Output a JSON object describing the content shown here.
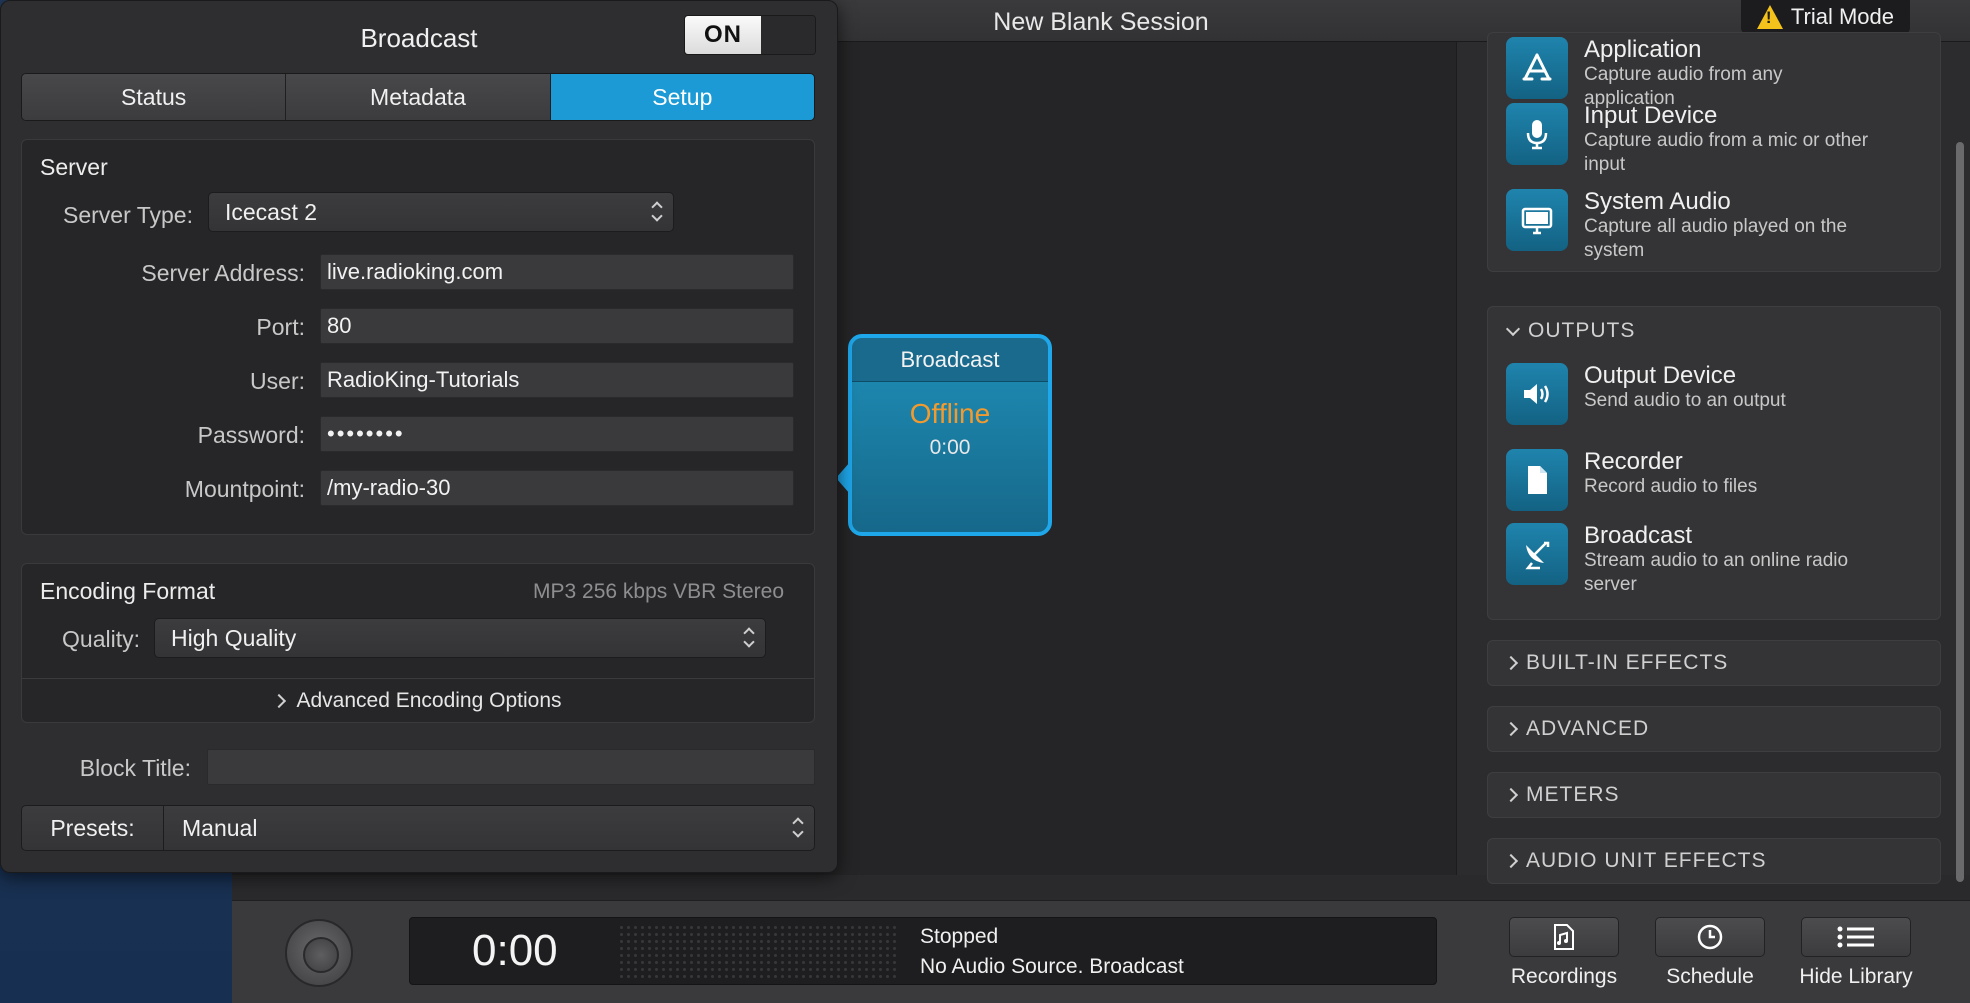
{
  "window": {
    "title": "New Blank Session",
    "trial_badge": "Trial Mode"
  },
  "panel": {
    "title": "Broadcast",
    "toggle": "ON",
    "tabs": [
      {
        "label": "Status",
        "active": false
      },
      {
        "label": "Metadata",
        "active": false
      },
      {
        "label": "Setup",
        "active": true
      }
    ],
    "server": {
      "heading": "Server",
      "type_label": "Server Type:",
      "type_value": "Icecast 2",
      "address_label": "Server Address:",
      "address_value": "live.radioking.com",
      "port_label": "Port:",
      "port_value": "80",
      "user_label": "User:",
      "user_value": "RadioKing-Tutorials",
      "password_label": "Password:",
      "password_value": "••••••••",
      "mountpoint_label": "Mountpoint:",
      "mountpoint_value": "/my-radio-30"
    },
    "encoding": {
      "heading": "Encoding Format",
      "summary": "MP3 256 kbps VBR Stereo",
      "quality_label": "Quality:",
      "quality_value": "High Quality",
      "advanced_label": "Advanced Encoding Options"
    },
    "block_title_label": "Block Title:",
    "block_title_value": "",
    "presets_label": "Presets:",
    "presets_value": "Manual"
  },
  "block": {
    "title": "Broadcast",
    "status": "Offline",
    "time": "0:00",
    "status_color": "#f39a2e",
    "accent": "#1ea7ea"
  },
  "library": {
    "sources": [
      {
        "title": "Application",
        "desc": "Capture audio from any application",
        "icon": "app-store-icon"
      },
      {
        "title": "Input Device",
        "desc": "Capture audio from a mic or other input",
        "icon": "microphone-icon"
      },
      {
        "title": "System Audio",
        "desc": "Capture all audio played on the system",
        "icon": "monitor-icon"
      }
    ],
    "outputs_heading": "OUTPUTS",
    "outputs": [
      {
        "title": "Output Device",
        "desc": "Send audio to an output",
        "icon": "speaker-icon"
      },
      {
        "title": "Recorder",
        "desc": "Record audio to files",
        "icon": "document-icon"
      },
      {
        "title": "Broadcast",
        "desc": "Stream audio to an online radio server",
        "icon": "satellite-dish-icon"
      }
    ],
    "collapsed_sections": [
      "BUILT-IN EFFECTS",
      "ADVANCED",
      "METERS",
      "AUDIO UNIT EFFECTS"
    ]
  },
  "transport": {
    "time": "0:00",
    "status_line1": "Stopped",
    "status_line2": "No Audio Source. Broadcast",
    "buttons": [
      {
        "label": "Recordings",
        "icon": "recordings-icon"
      },
      {
        "label": "Schedule",
        "icon": "clock-icon"
      },
      {
        "label": "Hide Library",
        "icon": "list-icon"
      }
    ]
  }
}
